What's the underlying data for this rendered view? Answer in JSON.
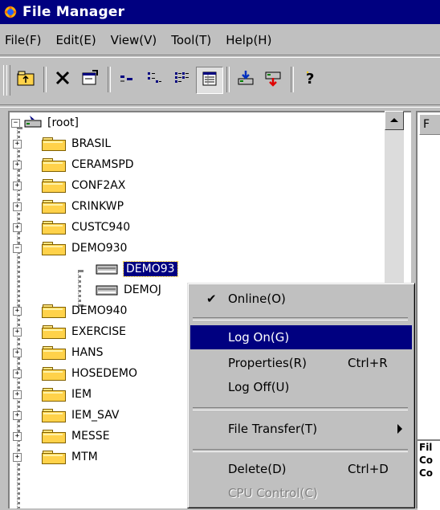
{
  "window": {
    "title": "File Manager"
  },
  "menu": [
    {
      "label": "File(F)"
    },
    {
      "label": "Edit(E)"
    },
    {
      "label": "View(V)"
    },
    {
      "label": "Tool(T)"
    },
    {
      "label": "Help(H)"
    }
  ],
  "toolbar": {
    "buttons": [
      {
        "icon": "up-folder-icon"
      },
      {
        "icon": "delete-x-icon"
      },
      {
        "icon": "properties-icon"
      },
      {
        "icon": "large-icons-icon"
      },
      {
        "icon": "small-icons-icon"
      },
      {
        "icon": "list-view-icon"
      },
      {
        "icon": "details-view-icon"
      },
      {
        "icon": "download-icon"
      },
      {
        "icon": "upload-icon"
      },
      {
        "icon": "help-icon"
      }
    ]
  },
  "tree": {
    "root_label": "[root]",
    "items": [
      {
        "label": "BRASIL",
        "expander": "+"
      },
      {
        "label": "CERAMSPD",
        "expander": "+"
      },
      {
        "label": "CONF2AX",
        "expander": "+"
      },
      {
        "label": "CRINKWP",
        "expander": "+"
      },
      {
        "label": "CUSTC940",
        "expander": "+"
      },
      {
        "label": "DEMO930",
        "expander": "-"
      },
      {
        "label": "DEMO93",
        "child": true,
        "selected": true
      },
      {
        "label": "DEMOJ",
        "child": true
      },
      {
        "label": "DEMO940",
        "expander": "+"
      },
      {
        "label": "EXERCISE",
        "expander": "+"
      },
      {
        "label": "HANS",
        "expander": "+"
      },
      {
        "label": "HOSEDEMO",
        "expander": "+"
      },
      {
        "label": "IEM",
        "expander": "+"
      },
      {
        "label": "IEM_SAV",
        "expander": "+"
      },
      {
        "label": "MESSE",
        "expander": "+"
      },
      {
        "label": "MTM",
        "expander": "+"
      }
    ]
  },
  "right_pane": {
    "header": "F",
    "bottom_lines": [
      "Fil",
      "Co",
      "Co"
    ]
  },
  "context_menu": {
    "items": [
      {
        "label": "Online(O)",
        "checked": true
      },
      {
        "label": "Log On(G)",
        "highlighted": true
      },
      {
        "label": "Properties(R)",
        "shortcut": "Ctrl+R"
      },
      {
        "label": "Log Off(U)"
      },
      {
        "label": "File Transfer(T)",
        "submenu": true
      },
      {
        "label": "Delete(D)",
        "shortcut": "Ctrl+D"
      },
      {
        "label": "CPU Control(C)",
        "disabled": true
      }
    ]
  },
  "colors": {
    "title_bar": "#000080",
    "selection": "#000080",
    "face": "#c0c0c0",
    "folder": "#ffd24a"
  }
}
